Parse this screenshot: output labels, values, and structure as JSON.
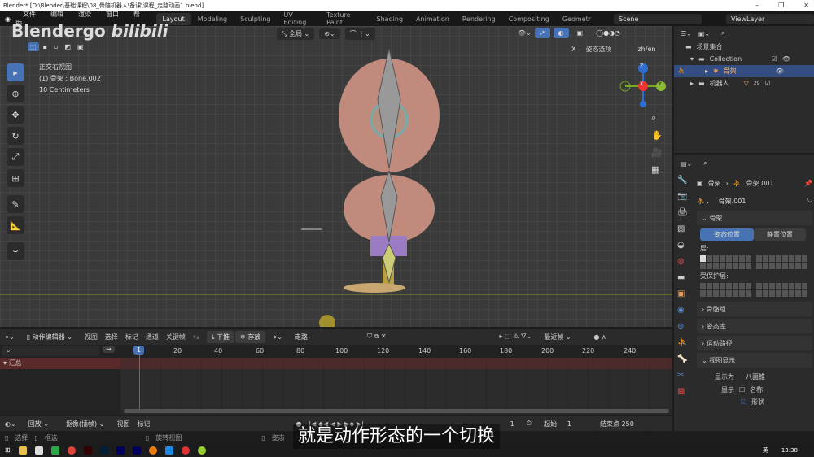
{
  "titlebar": {
    "title": "Blender* [D:\\Blender\\基础课程\\08_骨骼机器人\\备课\\课程_走路动画1.blend]",
    "minimize": "–",
    "maximize": "❐",
    "close": "✕"
  },
  "menu": [
    "文件",
    "编辑",
    "渲染",
    "窗口",
    "帮助"
  ],
  "workspaces": [
    "Layout",
    "Modeling",
    "Sculpting",
    "UV Editing",
    "Texture Paint",
    "Shading",
    "Animation",
    "Rendering",
    "Compositing",
    "Geometr"
  ],
  "active_workspace": "Layout",
  "scene": "Scene",
  "view_layer": "ViewLayer",
  "watermark": {
    "brand": "Blendergo",
    "site": "bilibili"
  },
  "viewport": {
    "transform_orientation": "全局",
    "overlay_lines": [
      "正交右视图",
      "(1) 骨架 : Bone.002",
      "10 Centimeters"
    ],
    "pose_options": "姿态选项",
    "lang_button": "zh/en",
    "mirror_x": "X",
    "gizmo": {
      "z": "Z",
      "x": "X",
      "y": "Y"
    }
  },
  "outliner": {
    "items": [
      {
        "label": "场景集合"
      },
      {
        "label": "Collection"
      },
      {
        "label": "骨架",
        "selected": true
      },
      {
        "label": "机器人",
        "badge": "29"
      }
    ]
  },
  "properties": {
    "breadcrumb": [
      "骨架",
      "骨架.001"
    ],
    "data_name": "骨架.001",
    "sections": {
      "skeleton": "骨架",
      "pose_position": "姿态位置",
      "rest_position": "静置位置",
      "layers": "层:",
      "protected_layers": "受保护层:",
      "bone_groups": "骨骼组",
      "pose_library": "姿态库",
      "motion_paths": "运动路径",
      "viewport_display": "视图显示",
      "display_as_label": "显示为",
      "display_as": "八面锥",
      "show_label": "显示",
      "names": "名称",
      "shapes": "形状"
    }
  },
  "dopesheet": {
    "mode": "动作编辑器",
    "menus": [
      "视图",
      "选择",
      "标记",
      "通道",
      "关键帧"
    ],
    "push_down": "下推",
    "stash": "存放",
    "action": "走路",
    "snapping": "最近帧",
    "current_frame": "1",
    "ruler": [
      "20",
      "40",
      "60",
      "80",
      "100",
      "120",
      "140",
      "160",
      "180",
      "200",
      "220",
      "240"
    ],
    "summary": "汇总"
  },
  "timeline": {
    "menus": [
      "回放",
      "抠像(插帧)",
      "视图",
      "标记"
    ],
    "frame": "1",
    "start_label": "起始",
    "start": "1",
    "end_label": "结束点",
    "end": "250"
  },
  "statusbar": {
    "items": [
      "选择",
      "框选",
      "旋转视图",
      "姿态"
    ],
    "time": "13:38",
    "ime": "英"
  },
  "subtitle": "就是动作形态的一个切换",
  "colors": {
    "accent": "#4772b3",
    "header": "#181818",
    "viewport": "#3a3a3a",
    "selection": "#334d80"
  }
}
